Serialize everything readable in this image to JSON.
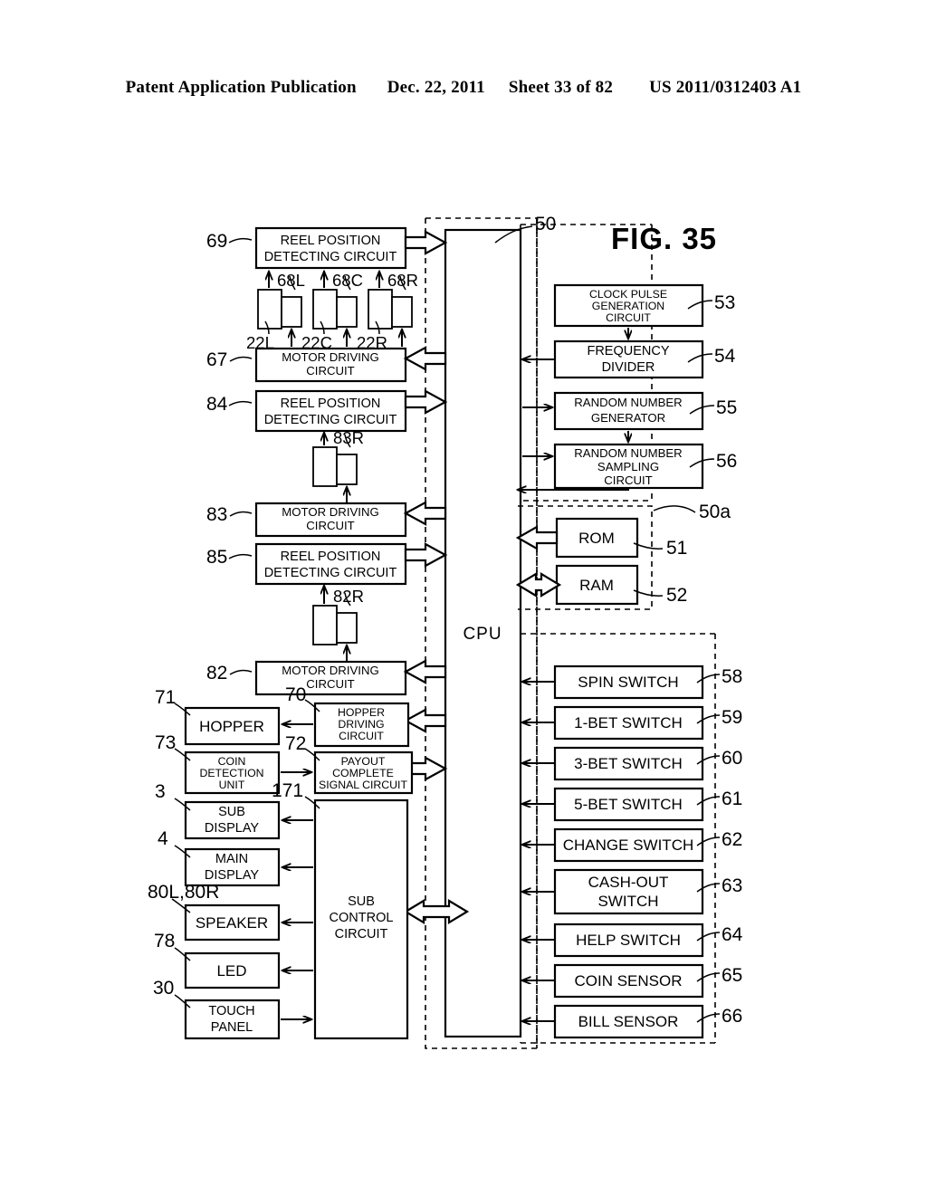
{
  "header": {
    "publication": "Patent Application Publication",
    "date": "Dec. 22, 2011",
    "sheet": "Sheet 33 of 82",
    "docnum": "US 2011/0312403 A1"
  },
  "figure": {
    "title": "FIG. 35"
  },
  "cpu": {
    "label": "CPU",
    "ref": "50",
    "memory_group_ref": "50a"
  },
  "left_column": [
    {
      "ref": "69",
      "label": "REEL POSITION\nDETECTING CIRCUIT",
      "name": "reel-position-detecting-circuit-69"
    },
    {
      "ref": "67",
      "label": "MOTOR DRIVING\nCIRCUIT",
      "name": "motor-driving-circuit-67"
    },
    {
      "ref": "84",
      "label": "REEL POSITION\nDETECTING CIRCUIT",
      "name": "reel-position-detecting-circuit-84"
    },
    {
      "ref": "83",
      "label": "MOTOR DRIVING\nCIRCUIT",
      "name": "motor-driving-circuit-83"
    },
    {
      "ref": "85",
      "label": "REEL POSITION\nDETECTING CIRCUIT",
      "name": "reel-position-detecting-circuit-85"
    },
    {
      "ref": "82",
      "label": "MOTOR DRIVING\nCIRCUIT",
      "name": "motor-driving-circuit-82"
    }
  ],
  "reel_units": {
    "sensors": [
      "68L",
      "68C",
      "68R"
    ],
    "motors": [
      "22L",
      "22C",
      "22R"
    ],
    "single_sensor_83": "83R",
    "single_sensor_82": "82R"
  },
  "peripherals": [
    {
      "ref": "71",
      "label": "HOPPER",
      "name": "hopper"
    },
    {
      "ref": "70",
      "label": "HOPPER\nDRIVING\nCIRCUIT",
      "name": "hopper-driving-circuit"
    },
    {
      "ref": "73",
      "label": "COIN\nDETECTION\nUNIT",
      "name": "coin-detection-unit"
    },
    {
      "ref": "72",
      "label": "PAYOUT\nCOMPLETE\nSIGNAL CIRCUIT",
      "name": "payout-complete-signal-circuit"
    },
    {
      "ref": "3",
      "label": "SUB\nDISPLAY",
      "name": "sub-display"
    },
    {
      "ref": "4",
      "label": "MAIN\nDISPLAY",
      "name": "main-display"
    },
    {
      "ref": "80L,80R",
      "label": "SPEAKER",
      "name": "speaker"
    },
    {
      "ref": "78",
      "label": "LED",
      "name": "led"
    },
    {
      "ref": "30",
      "label": "TOUCH\nPANEL",
      "name": "touch-panel"
    },
    {
      "ref": "171",
      "label": "SUB\nCONTROL\nCIRCUIT",
      "name": "sub-control-circuit"
    }
  ],
  "right_column": [
    {
      "ref": "53",
      "label": "CLOCK PULSE\nGENERATION\nCIRCUIT",
      "name": "clock-pulse-generation-circuit"
    },
    {
      "ref": "54",
      "label": "FREQUENCY\nDIVIDER",
      "name": "frequency-divider"
    },
    {
      "ref": "55",
      "label": "RANDOM NUMBER\nGENERATOR",
      "name": "random-number-generator"
    },
    {
      "ref": "56",
      "label": "RANDOM NUMBER\nSAMPLING\nCIRCUIT",
      "name": "random-number-sampling-circuit"
    },
    {
      "ref": "51",
      "label": "ROM",
      "name": "rom"
    },
    {
      "ref": "52",
      "label": "RAM",
      "name": "ram"
    },
    {
      "ref": "58",
      "label": "SPIN SWITCH",
      "name": "spin-switch"
    },
    {
      "ref": "59",
      "label": "1-BET SWITCH",
      "name": "one-bet-switch"
    },
    {
      "ref": "60",
      "label": "3-BET SWITCH",
      "name": "three-bet-switch"
    },
    {
      "ref": "61",
      "label": "5-BET SWITCH",
      "name": "five-bet-switch"
    },
    {
      "ref": "62",
      "label": "CHANGE SWITCH",
      "name": "change-switch"
    },
    {
      "ref": "63",
      "label": "CASH-OUT\nSWITCH",
      "name": "cash-out-switch"
    },
    {
      "ref": "64",
      "label": "HELP SWITCH",
      "name": "help-switch"
    },
    {
      "ref": "65",
      "label": "COIN SENSOR",
      "name": "coin-sensor"
    },
    {
      "ref": "66",
      "label": "BILL SENSOR",
      "name": "bill-sensor"
    }
  ]
}
